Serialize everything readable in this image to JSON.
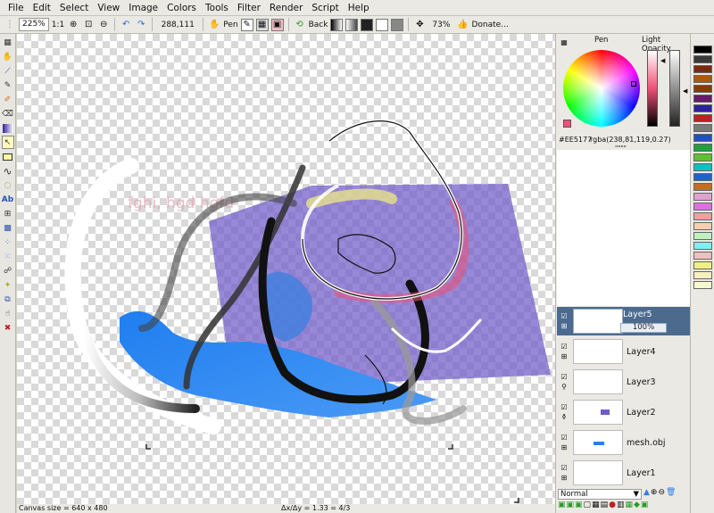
{
  "menu": [
    "File",
    "Edit",
    "Select",
    "View",
    "Image",
    "Colors",
    "Tools",
    "Filter",
    "Render",
    "Script",
    "Help"
  ],
  "toolbar": {
    "zoom_value": "225%",
    "ratio_label": "1:1",
    "coords": "288,111",
    "pen_label": "Pen",
    "back_label": "Back",
    "opacity_value": "73%",
    "donate_label": "Donate..."
  },
  "panel": {
    "pen_label": "Pen",
    "light_opacity_label": "Light Opacity",
    "hex_color": "#EE5177",
    "rgba_color": "rgba(238,81,119,0.27)",
    "current_color": "#ee5177",
    "blend_mode": "Normal"
  },
  "layers": [
    {
      "name": "Layer5",
      "opacity": "100%",
      "selected": true
    },
    {
      "name": "Layer4",
      "selected": false
    },
    {
      "name": "Layer3",
      "selected": false
    },
    {
      "name": "Layer2",
      "selected": false
    },
    {
      "name": "mesh.obj",
      "selected": false
    },
    {
      "name": "Layer1",
      "selected": false
    }
  ],
  "canvas": {
    "text": "fghi,  hgd hgfd"
  },
  "status": {
    "canvas_size": "Canvas size = 640 x 480",
    "delta": "Δx/Δy = 1.33 = 4/3"
  },
  "palette": [
    "#000000",
    "#3a3a3a",
    "#7a2a0a",
    "#a85a10",
    "#8a3a00",
    "#6a1a6a",
    "#3020a0",
    "#c02020",
    "#7a7a7a",
    "#2050c0",
    "#20a040",
    "#60c030",
    "#10c0c0",
    "#2060d0",
    "#c07020",
    "#e0a0d0",
    "#e070e0",
    "#f0a0a0",
    "#f5d0b0",
    "#c0f0c0",
    "#80f0f0",
    "#f0c0c0",
    "#f0f080",
    "#f8f0c0",
    "#f8f8d0"
  ]
}
